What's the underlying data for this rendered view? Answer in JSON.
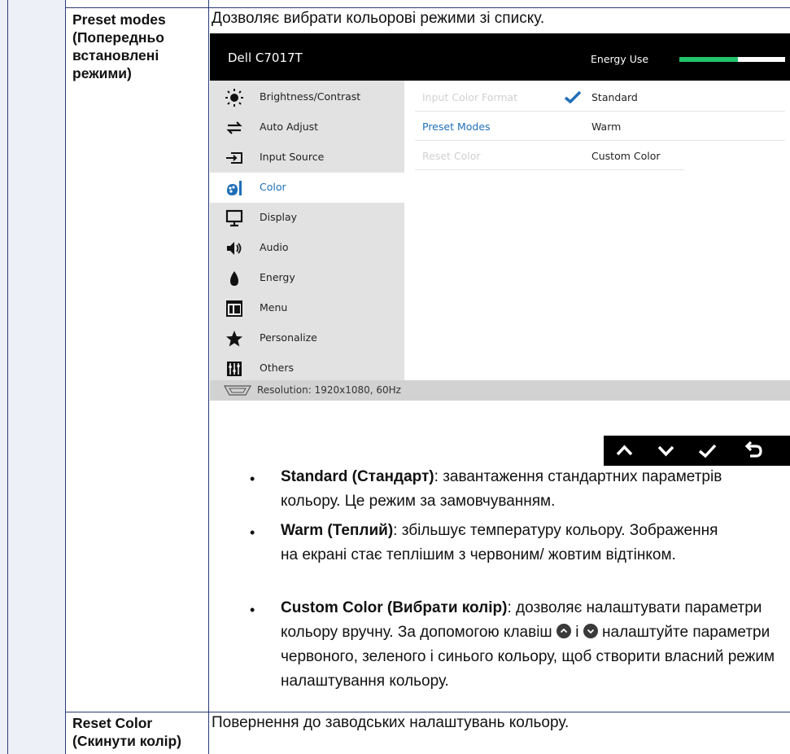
{
  "rows": [
    {
      "label": "Preset modes\n(Попередньо\nвстановлені\nрежими)",
      "description": "Дозволяє вибрати кольорові режими зі списку."
    },
    {
      "label": "Reset Color\n(Скинути колір)",
      "description": "Повернення до заводських налаштувань кольору."
    }
  ],
  "osd": {
    "title": "Dell C7017T",
    "energy_label": "Energy Use",
    "energy_level": 0.55,
    "menu": [
      {
        "label": "Brightness/Contrast",
        "icon": "brightness-icon"
      },
      {
        "label": "Auto Adjust",
        "icon": "auto-adjust-icon"
      },
      {
        "label": "Input Source",
        "icon": "input-source-icon"
      },
      {
        "label": "Color",
        "icon": "color-icon",
        "active": true
      },
      {
        "label": "Display",
        "icon": "display-icon"
      },
      {
        "label": "Audio",
        "icon": "audio-icon"
      },
      {
        "label": "Energy",
        "icon": "energy-icon"
      },
      {
        "label": "Menu",
        "icon": "menu-icon"
      },
      {
        "label": "Personalize",
        "icon": "personalize-icon"
      },
      {
        "label": "Others",
        "icon": "others-icon"
      }
    ],
    "submenu": [
      {
        "name": "Input Color Format",
        "value": "Standard",
        "checked": true
      },
      {
        "name": "Preset Modes",
        "value": "Warm",
        "active": true
      },
      {
        "name": "Reset Color",
        "value": "Custom Color"
      }
    ],
    "status": "Resolution: 1920x1080, 60Hz"
  },
  "nav_buttons": [
    "up-arrow-icon",
    "down-arrow-icon",
    "check-icon",
    "back-icon"
  ],
  "bullets": [
    {
      "title": "Standard (Стандарт)",
      "text": ": завантаження стандартних параметрів кольору. Це режим за замовчуванням."
    },
    {
      "title": "Warm (Теплий)",
      "text": ": збільшує температуру кольору. Зображення на екрані стає теплішим з червоним/ жовтим відтінком."
    },
    {
      "title": "Custom Color (Вибрати колір)",
      "text": ": дозволяє налаштувати параметри кольору вручну. За допомогою клавіш",
      "after_keys": "налаштуйте параметри червоного, зеленого і синього кольору, щоб створити власний режим налаштування кольору.",
      "conjunction": "і"
    }
  ],
  "colors": {
    "accent": "#1f6fb8",
    "energy": "#22c36a",
    "border": "#2a3b7a"
  }
}
